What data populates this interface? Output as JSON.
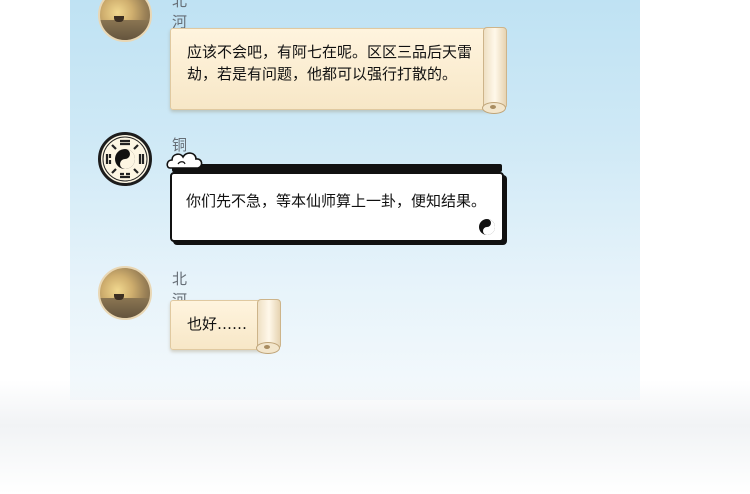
{
  "messages": [
    {
      "sender": "北河散人",
      "text": "应该不会吧，有阿七在呢。区区三品后天雷劫，若是有问题，他都可以强行打散的。",
      "avatar_icon": "sunset-avatar-icon",
      "style": "scroll"
    },
    {
      "sender": "铜挂仙师",
      "text": "你们先不急，等本仙师算上一卦，便知结果。",
      "avatar_icon": "bagua-avatar-icon",
      "style": "ink"
    },
    {
      "sender": "北河散人",
      "text": "也好……",
      "avatar_icon": "sunset-avatar-icon",
      "style": "scroll"
    }
  ],
  "colors": {
    "panel_top": "#bfe2f3",
    "panel_bottom": "#f4f9fc",
    "scroll_bubble": "#f7e7c7",
    "ink_bubble_border": "#111111",
    "sender_name": "#666e76"
  }
}
